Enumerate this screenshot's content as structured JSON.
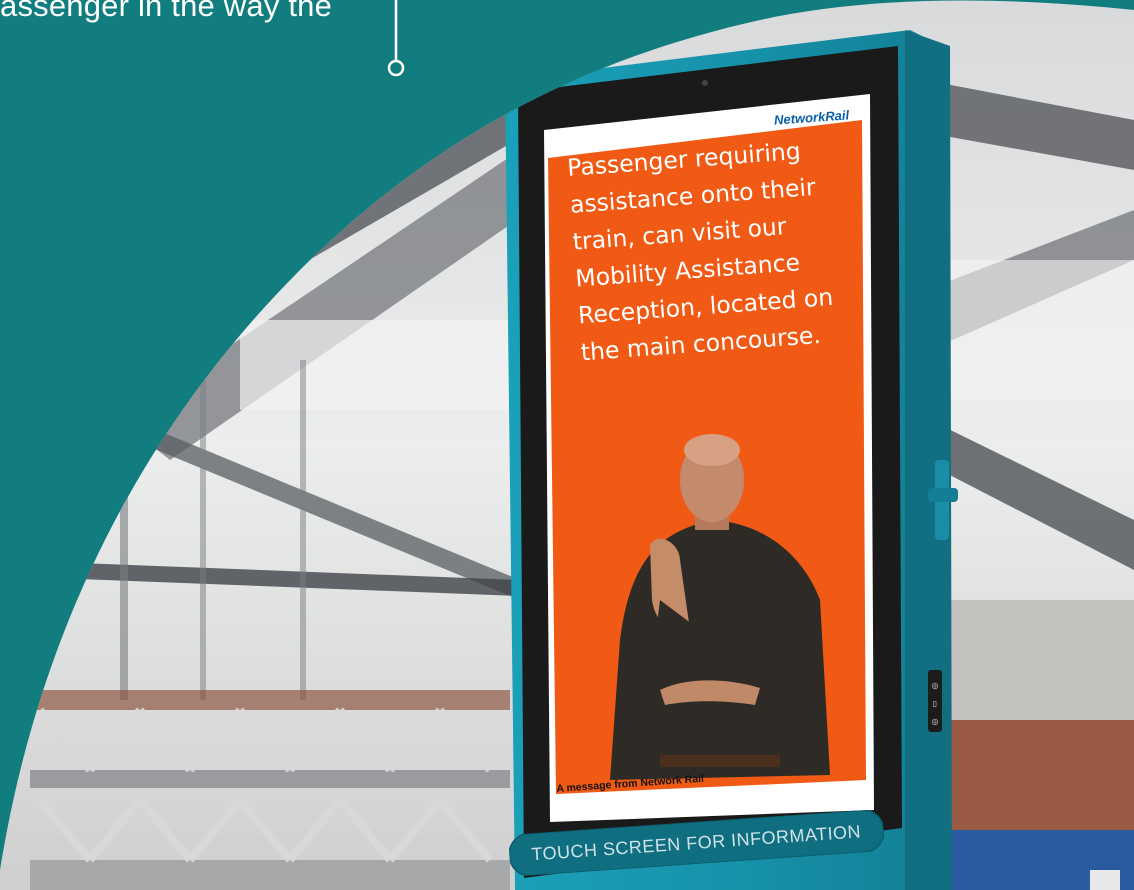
{
  "caption_fragment": "assenger in the way the",
  "kiosk": {
    "logo": "NetworkRail",
    "message_lines": [
      "Passenger requiring",
      "assistance onto their",
      "train, can visit our",
      "Mobility Assistance",
      "Reception, located on",
      "the main concourse."
    ],
    "footer": "A message from Network Rail",
    "touch_button": "TOUCH SCREEN FOR INFORMATION"
  },
  "colors": {
    "teal": "#117d7e",
    "kiosk_frame": "#1a98b0",
    "screen_orange": "#f05a14",
    "logo_blue": "#0b5fa8"
  }
}
